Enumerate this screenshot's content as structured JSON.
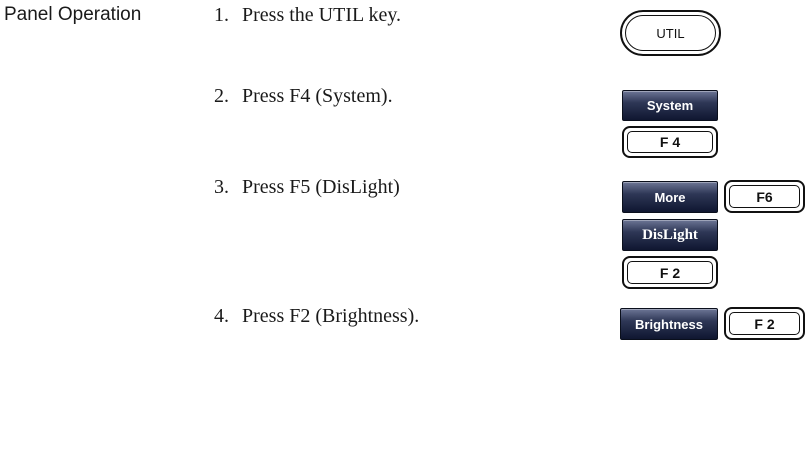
{
  "section_label": "Panel Operation",
  "steps": [
    {
      "num": "1.",
      "text": "Press the UTIL key."
    },
    {
      "num": "2.",
      "text": "Press F4 (System)."
    },
    {
      "num": "3.",
      "text": "Press F5 (DisLight)"
    },
    {
      "num": "4.",
      "text": "Press F2 (Brightness)."
    }
  ],
  "keys": {
    "util": "UTIL",
    "system": "System",
    "f4": "F 4",
    "more": "More",
    "f6": "F6",
    "dislight": "DisLight",
    "f2_step3": "F 2",
    "brightness": "Brightness",
    "f2_step4": "F 2"
  }
}
